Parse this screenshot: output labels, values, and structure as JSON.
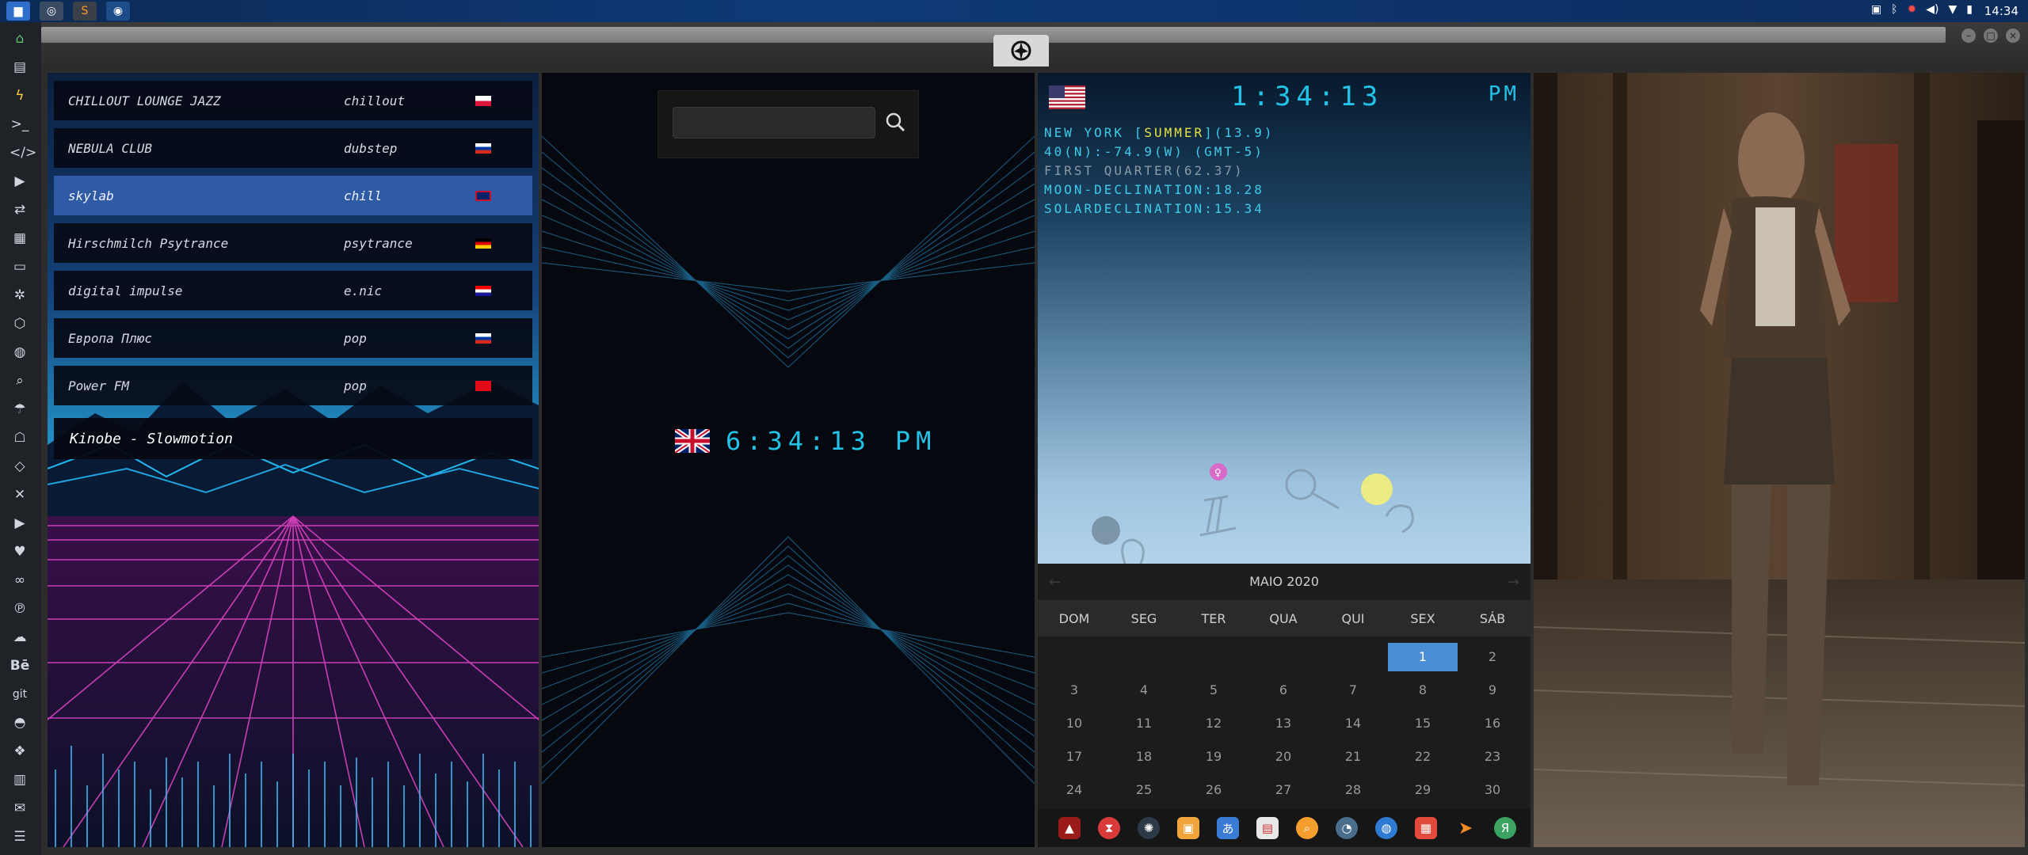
{
  "topbar": {
    "time": "14:34",
    "tray_icons": [
      "screenshot-icon",
      "bluetooth-icon",
      "settings-alert-icon",
      "volume-icon",
      "wifi-icon",
      "battery-icon"
    ]
  },
  "radio": {
    "stations": [
      {
        "name": "CHILLOUT LOUNGE JAZZ",
        "genre": "chillout",
        "flag": "poland",
        "active": false
      },
      {
        "name": "NEBULA CLUB",
        "genre": "dubstep",
        "flag": "russia",
        "active": false
      },
      {
        "name": "skylab",
        "genre": "chill",
        "flag": "uk",
        "active": true
      },
      {
        "name": "Hirschmilch Psytrance",
        "genre": "psytrance",
        "flag": "germany",
        "active": false
      },
      {
        "name": "digital impulse",
        "genre": "e.nic",
        "flag": "croatia",
        "active": false
      },
      {
        "name": "Европа Плюс",
        "genre": "pop",
        "flag": "russia",
        "active": false
      },
      {
        "name": "Power FM",
        "genre": "pop",
        "flag": "turkey",
        "active": false
      }
    ],
    "now_playing": "Kinobe - Slowmotion"
  },
  "clock": {
    "search_placeholder": "",
    "time": "6:34:13",
    "ampm": "PM",
    "flag": "uk"
  },
  "astro": {
    "flag": "usa",
    "time": "1:34:13",
    "ampm": "PM",
    "line1_pre": "NEW YORK [",
    "line1_hl": "SUMMER",
    "line1_post": "](13.9)",
    "line2": "40(N):-74.9(W) (GMT-5)",
    "line3": "FIRST QUARTER(62.37)",
    "line4": "MOON-DECLINATION:18.28",
    "line5": "SOLARDECLINATION:15.34"
  },
  "calendar": {
    "title": "MAIO 2020",
    "days_of_week": [
      "DOM",
      "SEG",
      "TER",
      "QUA",
      "QUI",
      "SEX",
      "SÁB"
    ],
    "weeks": [
      [
        "",
        "",
        "",
        "",
        "",
        "1",
        "2"
      ],
      [
        "3",
        "4",
        "5",
        "6",
        "7",
        "8",
        "9"
      ],
      [
        "10",
        "11",
        "12",
        "13",
        "14",
        "15",
        "16"
      ],
      [
        "17",
        "18",
        "19",
        "20",
        "21",
        "22",
        "23"
      ],
      [
        "24",
        "25",
        "26",
        "27",
        "28",
        "29",
        "30"
      ]
    ],
    "selected": "1"
  },
  "taskbar_icons": [
    "ark-icon",
    "hourglass-icon",
    "system-icon",
    "photos-icon",
    "translate-icon",
    "notes-icon",
    "search-icon",
    "clock-icon",
    "globe-icon",
    "calendar-icon",
    "arrow-icon",
    "yandex-icon"
  ],
  "colors": {
    "accent_cyan": "#23c3e8",
    "active_station": "#2f5ba6",
    "calendar_selected": "#4a8ed6",
    "summer_highlight": "#e6e23d"
  }
}
